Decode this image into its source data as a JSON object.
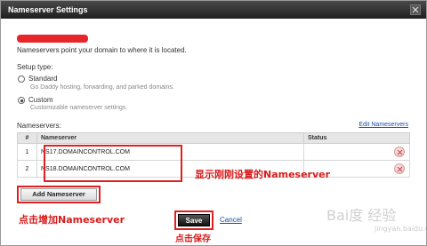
{
  "window": {
    "title": "Nameserver Settings"
  },
  "intro_text": "Nameservers point your domain to where it is located.",
  "setup": {
    "label": "Setup type:",
    "options": [
      {
        "label": "Standard",
        "description": "Go Daddy hosting, forwarding, and parked domains.",
        "selected": false
      },
      {
        "label": "Custom",
        "description": "Customizable nameserver settings.",
        "selected": true
      }
    ]
  },
  "nameservers": {
    "label": "Nameservers:",
    "edit_link": "Edit Nameservers",
    "columns": [
      "#",
      "Nameserver",
      "Status"
    ],
    "rows": [
      {
        "num": "1",
        "nameserver": "NS17.DOMAINCONTROL.COM",
        "status": ""
      },
      {
        "num": "2",
        "nameserver": "NS18.DOMAINCONTROL.COM",
        "status": ""
      }
    ],
    "add_button": "Add Nameserver"
  },
  "actions": {
    "save": "Save",
    "cancel": "Cancel"
  },
  "annotations": {
    "nameserver_note": "显示刚刚设置的Nameserver",
    "add_note": "点击增加Nameserver",
    "save_note": "点击保存"
  },
  "watermark": {
    "brand": "Bai度 经验",
    "sub": "jingyan.baidu.com"
  },
  "colors": {
    "annotation_red": "#e02020",
    "title_bar": "#2b2b2b",
    "link_blue": "#1a4fa8"
  }
}
